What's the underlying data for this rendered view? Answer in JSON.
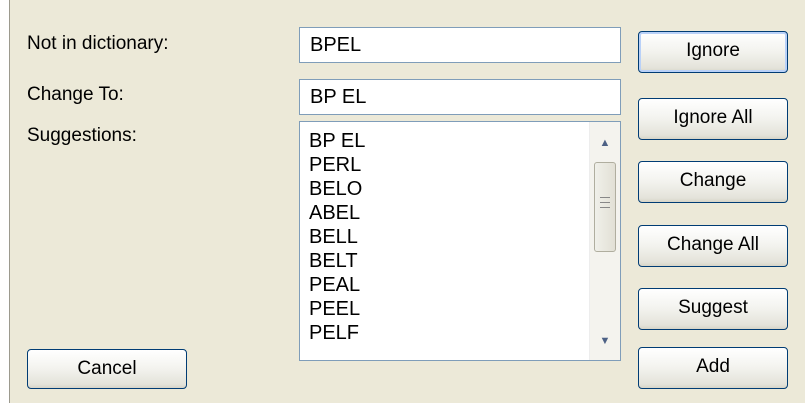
{
  "labels": {
    "not_in_dictionary": "Not in dictionary:",
    "change_to": "Change To:",
    "suggestions": "Suggestions:"
  },
  "fields": {
    "not_in_dictionary_value": "BPEL",
    "change_to_value": "BP EL"
  },
  "suggestions": [
    "BP EL",
    "PERL",
    "BELO",
    "ABEL",
    "BELL",
    "BELT",
    "PEAL",
    "PEEL",
    "PELF"
  ],
  "buttons": {
    "ignore": "Ignore",
    "ignore_all": "Ignore All",
    "change": "Change",
    "change_all": "Change All",
    "suggest": "Suggest",
    "add": "Add",
    "cancel": "Cancel"
  },
  "icons": {
    "scroll_up": "scroll-up-arrow-icon",
    "scroll_down": "scroll-down-arrow-icon",
    "scroll_grip": "scroll-grip-icon"
  }
}
